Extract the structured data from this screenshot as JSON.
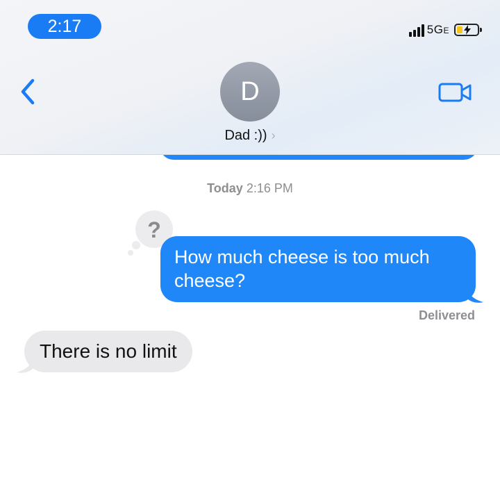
{
  "status_bar": {
    "time": "2:17",
    "network": "5G",
    "network_suffix": "E"
  },
  "header": {
    "avatar_initial": "D",
    "contact_name": "Dad :))",
    "contact_chevron": "›"
  },
  "icons": {
    "back": "chevron-left-icon",
    "facetime": "video-camera-icon",
    "thought": "question-thought-bubble-icon"
  },
  "colors": {
    "accent": "#1a7cf5",
    "outgoing_bubble": "#1f87f7",
    "incoming_bubble": "#e9e9eb",
    "meta_text": "#8e8e93"
  },
  "conversation": {
    "timestamp_day": "Today",
    "timestamp_time": "2:16 PM",
    "messages": [
      {
        "direction": "outgoing",
        "text": "How much cheese is too much cheese?",
        "status": "Delivered"
      },
      {
        "direction": "incoming",
        "text": "There is no limit"
      }
    ]
  }
}
